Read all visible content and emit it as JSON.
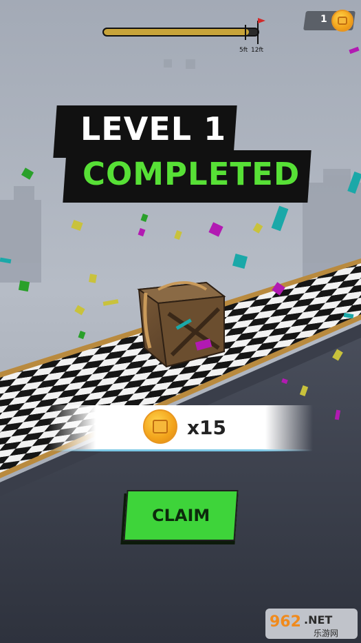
{
  "progress": {
    "fraction": 0.94,
    "markers": [
      "5ft",
      "12ft"
    ]
  },
  "coins": {
    "count": "1",
    "icon": "coin-icon"
  },
  "banner": {
    "level": "LEVEL 1",
    "status": "COMPLETED",
    "status_color": "#57e036"
  },
  "reward": {
    "amount": "x15",
    "icon": "coin-icon"
  },
  "claim": {
    "label": "CLAIM",
    "color": "#3ed43a"
  },
  "watermark": {
    "text": "962.NET 乐游网"
  }
}
